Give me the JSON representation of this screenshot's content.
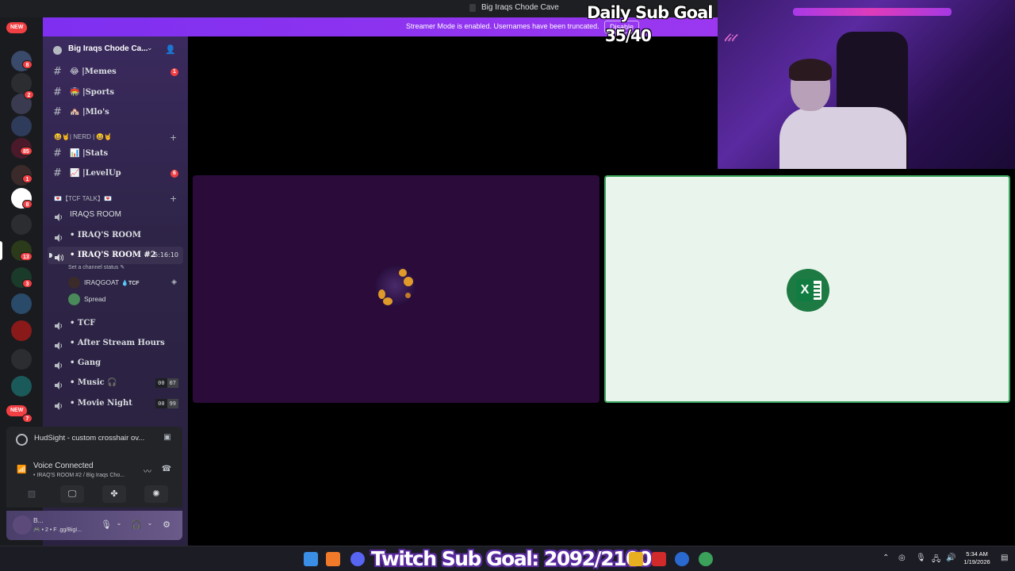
{
  "window": {
    "title": "Big Iraqs Chode Cave"
  },
  "banner": {
    "text": "Streamer Mode is enabled. Usernames have been truncated.",
    "disable_label": "Disable"
  },
  "rail": {
    "new_label_top": "NEW",
    "new_label_bottom": "NEW",
    "badges": [
      "8",
      "2",
      "85",
      "1",
      "8",
      "13",
      "3",
      "7"
    ]
  },
  "guild": {
    "name": "Big Iraqs Chode Ca..."
  },
  "channels": {
    "memes": {
      "emoji": "😂",
      "name": "|Memes",
      "unread": "1"
    },
    "sports": {
      "emoji": "🏟️",
      "name": "|Sports"
    },
    "mlos": {
      "emoji": "🏘️",
      "name": "|Mlo's"
    },
    "cat_nerd": "😆🤘| NERD | 😆🤘",
    "stats": {
      "emoji": "📊",
      "name": "|Stats"
    },
    "levelup": {
      "emoji": "📈",
      "name": "|LevelUp",
      "unread": "6"
    },
    "cat_tcf": "💌【TCF TALK】💌",
    "iraqs_room": {
      "name": "IRAQS ROOM"
    },
    "iraqs_room_dot": {
      "name": "• IRAQ'S ROOM"
    },
    "iraqs_room2": {
      "name": "• IRAQ'S ROOM #2",
      "time": "5:16:10",
      "status": "Set a channel status ✎"
    },
    "tcf": {
      "name": "• TCF"
    },
    "after_stream": {
      "name": "• After Stream Hours"
    },
    "gang": {
      "name": "• Gang"
    },
    "music": {
      "name": "• Music 🎧",
      "count_a": "00",
      "count_b": "07"
    },
    "movie": {
      "name": "• Movie Night",
      "count_a": "00",
      "count_b": "99"
    }
  },
  "voice_users": [
    {
      "name": "IRAQGOAT",
      "tag": "💧TCF"
    },
    {
      "name": "Spread",
      "tag": ""
    }
  ],
  "activity": {
    "text": "HudSight - custom crosshair ov..."
  },
  "voice": {
    "status": "Voice Connected",
    "location": "• IRAQ'S ROOM #2 / Big Iraqs Cho..."
  },
  "user": {
    "name": "B...",
    "sub": "🎮 • 2 • F .gg/BigI..."
  },
  "overlay": {
    "goal_title": "Daily Sub Goal",
    "goal_count": "35/40",
    "cam_sign": "𝓁𝒾𝓉"
  },
  "taskbar": {
    "twitch_goal": "Twitch Sub Goal: 2092/2100",
    "time": "5:34 AM",
    "date": "1/19/2026"
  }
}
